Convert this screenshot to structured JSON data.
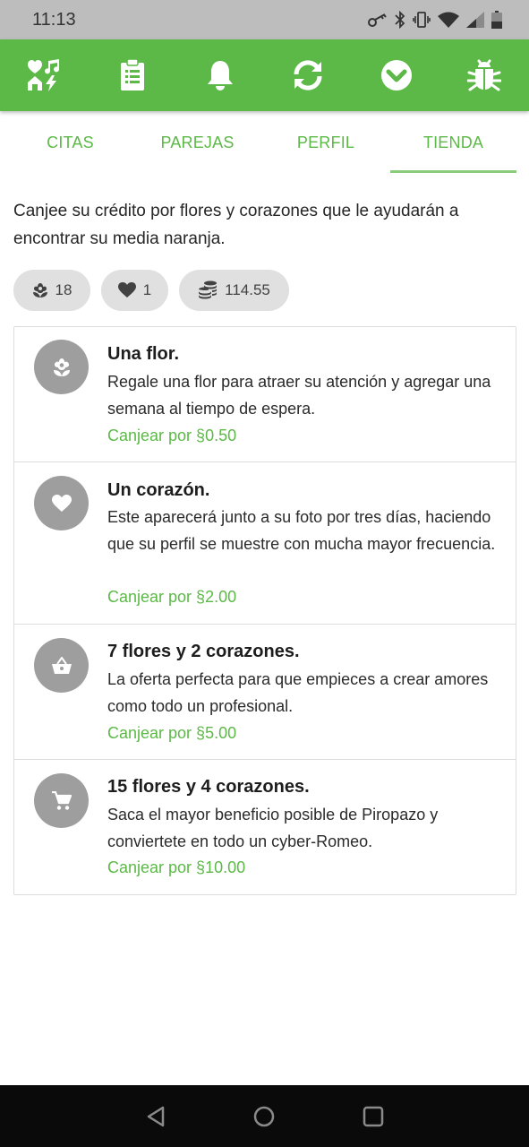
{
  "status_bar": {
    "time": "11:13",
    "icons": [
      "key-icon",
      "bluetooth-icon",
      "vibrate-icon",
      "wifi-icon",
      "signal-icon",
      "battery-icon"
    ]
  },
  "toolbar": {
    "color": "#5cb947",
    "icons": [
      "matches-icon",
      "clipboard-icon",
      "bell-icon",
      "refresh-icon",
      "chevron-down-circle-icon",
      "bug-icon"
    ]
  },
  "tabs": [
    {
      "label": "CITAS"
    },
    {
      "label": "PAREJAS"
    },
    {
      "label": "PERFIL"
    },
    {
      "label": "TIENDA",
      "selected": true
    }
  ],
  "intro": "Canjee su crédito por flores y corazones que le ayudarán a encontrar su media naranja.",
  "balances": {
    "flowers": "18",
    "hearts": "1",
    "credit": "114.55"
  },
  "store_items": [
    {
      "icon": "flower-icon",
      "title": "Una flor.",
      "description": "Regale una flor para atraer su atención y agregar una semana al tiempo de espera.",
      "price_label": "Canjear por §0.50"
    },
    {
      "icon": "heart-icon",
      "title": "Un corazón.",
      "description": "Este aparecerá junto a su foto por tres días, haciendo que su perfil se muestre con mucha mayor frecuencia.",
      "price_label": "Canjear por §2.00"
    },
    {
      "icon": "basket-icon",
      "title": "7 flores y 2 corazones.",
      "description": "La oferta perfecta para que empieces a crear amores como todo un profesional.",
      "price_label": "Canjear por §5.00"
    },
    {
      "icon": "cart-icon",
      "title": "15 flores y 4 corazones.",
      "description": "Saca el mayor beneficio posible de Piropazo y conviertete en todo un cyber-Romeo.",
      "price_label": "Canjear por §10.00"
    }
  ],
  "nav_bar": {
    "buttons": [
      "back-icon",
      "home-icon",
      "recents-icon"
    ]
  }
}
